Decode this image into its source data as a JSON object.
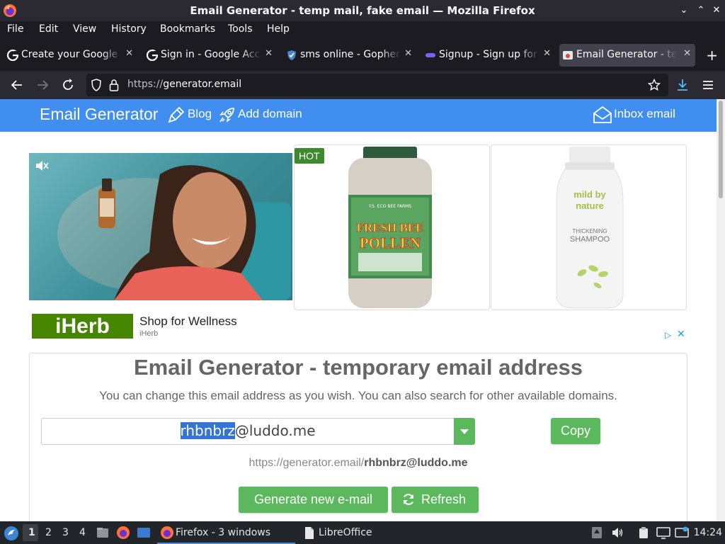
{
  "window": {
    "title": "Email Generator - temp mail, fake email — Mozilla Firefox"
  },
  "menu": [
    "File",
    "Edit",
    "View",
    "History",
    "Bookmarks",
    "Tools",
    "Help"
  ],
  "tabs": [
    {
      "label": "Create your Google Account",
      "icon": "google-icon"
    },
    {
      "label": "Sign in - Google Accounts",
      "icon": "google-icon"
    },
    {
      "label": "sms online - Gopher",
      "icon": "shield-check-icon"
    },
    {
      "label": "Signup - Sign up for",
      "icon": "signup-icon"
    },
    {
      "label": "Email Generator - temp",
      "icon": "email-generator-icon",
      "active": true
    }
  ],
  "nav": {
    "url_proto": "https://",
    "url_host": "generator.email"
  },
  "site": {
    "brand": "Email Generator",
    "blog": "Blog",
    "add_domain": "Add domain",
    "inbox": "Inbox email"
  },
  "ad": {
    "hot": "HOT",
    "logo": "iHerb",
    "headline": "Shop for Wellness",
    "source": "iHerb",
    "product1": {
      "brand_line": "Y.S. ECO BEE FARMS",
      "name_top": "FRESH BEE",
      "name_bottom": "POLLEN"
    },
    "product2": {
      "brand_top": "mild by",
      "brand_bottom": "nature",
      "name_top": "THICKENING",
      "name_bottom": "SHAMPOO"
    }
  },
  "main": {
    "heading": "Email Generator - temporary email address",
    "subtitle": "You can change this email address as you wish. You can also search for other available domains.",
    "email_user": "rhbnbrz",
    "email_domain": "@luddo.me",
    "copy_label": "Copy",
    "url_prefix": "https://generator.email/",
    "url_email": "rhbnbrz@luddo.me",
    "generate_label": "Generate new e-mail",
    "refresh_label": "Refresh"
  },
  "taskbar": {
    "workspaces": [
      "1",
      "2",
      "3",
      "4"
    ],
    "firefox_task": "Firefox - 3 windows",
    "libreoffice_task": "LibreOffice",
    "clock": "14:24"
  },
  "colors": {
    "site_blue": "#3f8ef0",
    "button_green": "#5cb85c",
    "selection": "#3574d4"
  }
}
